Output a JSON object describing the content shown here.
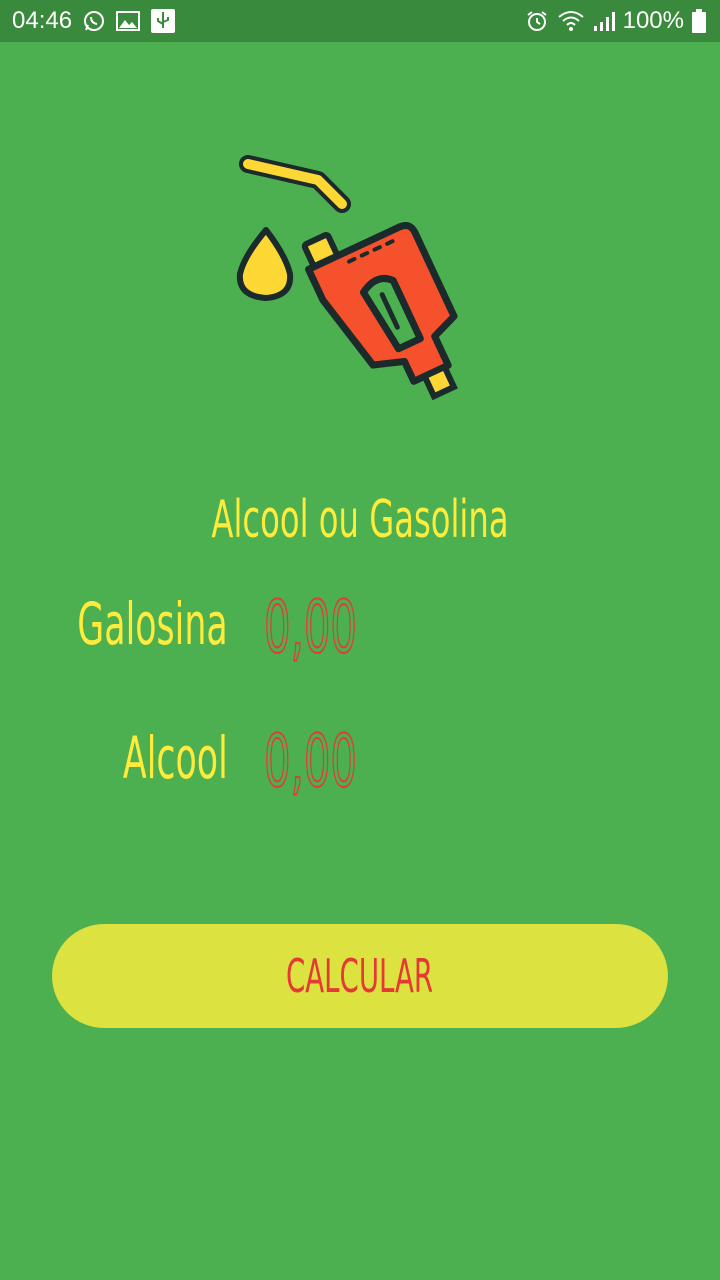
{
  "status_bar": {
    "time": "04:46",
    "battery": "100%",
    "left_icons": [
      "whatsapp-icon",
      "image-icon",
      "usb-icon"
    ],
    "right_icons": [
      "alarm-icon",
      "wifi-icon",
      "signal-icon",
      "battery-icon"
    ]
  },
  "app": {
    "title": "Alcool ou Gasolina",
    "fields": {
      "gasolina": {
        "label": "Galosina",
        "placeholder": "0,00"
      },
      "alcool": {
        "label": "Alcool",
        "placeholder": "0,00"
      }
    },
    "calculate_button": "CALCULAR",
    "logo_icon": "fuel-pump-nozzle-icon"
  },
  "colors": {
    "background": "#4caf50",
    "status_bar": "#3a8a3d",
    "title_text": "#ffeb3b",
    "value_text": "#e53935",
    "button_bg": "#dce23f",
    "button_text": "#e53935"
  }
}
